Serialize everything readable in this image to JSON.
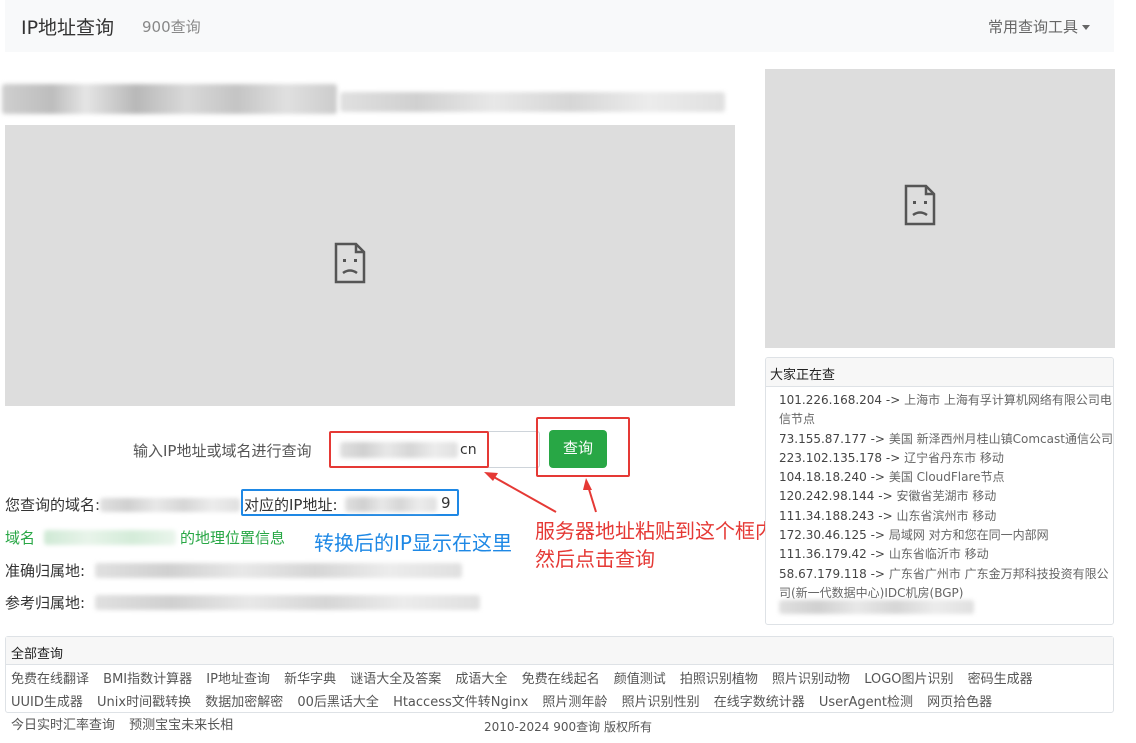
{
  "navbar": {
    "brand": "IP地址查询",
    "sub": "900查询",
    "tools": "常用查询工具"
  },
  "search": {
    "label": "输入IP地址或域名进行查询",
    "input_value_visible": "cn",
    "button": "查询"
  },
  "results": {
    "domain_label": "您查询的域名:",
    "ip_label": "对应的IP地址:",
    "ip_tail": "9",
    "geo_prefix": "域名",
    "geo_suffix": "的地理位置信息",
    "accurate_label": "准确归属地:",
    "reference_label": "参考归属地:"
  },
  "annotations": {
    "blue": "转换后的IP显示在这里",
    "red_line1": "服务器地址粘贴到这个框内",
    "red_line2": "然后点击查询"
  },
  "side_panel": {
    "title": "大家正在查",
    "items": [
      {
        "ip": "101.226.168.204 ->",
        "loc": "上海市 上海有孚计算机网络有限公司电信节点"
      },
      {
        "ip": "73.155.87.177 ->",
        "loc": "美国 新泽西州月桂山镇Comcast通信公司"
      },
      {
        "ip": "223.102.135.178 ->",
        "loc": "辽宁省丹东市 移动"
      },
      {
        "ip": "104.18.18.240 ->",
        "loc": "美国 CloudFlare节点"
      },
      {
        "ip": "120.242.98.144 ->",
        "loc": "安徽省芜湖市 移动"
      },
      {
        "ip": "111.34.188.243 ->",
        "loc": "山东省滨州市 移动"
      },
      {
        "ip": "172.30.46.125 ->",
        "loc": "局域网 对方和您在同一内部网"
      },
      {
        "ip": "111.36.179.42 ->",
        "loc": "山东省临沂市 移动"
      },
      {
        "ip": "58.67.179.118 ->",
        "loc": "广东省广州市 广东金万邦科技投资有限公司(新一代数据中心)IDC机房(BGP)"
      }
    ]
  },
  "all_queries": {
    "title": "全部查询",
    "links": [
      "免费在线翻译",
      "BMI指数计算器",
      "IP地址查询",
      "新华字典",
      "谜语大全及答案",
      "成语大全",
      "免费在线起名",
      "颜值测试",
      "拍照识别植物",
      "照片识别动物",
      "LOGO图片识别",
      "密码生成器",
      "UUID生成器",
      "Unix时间戳转换",
      "数据加密解密",
      "00后黑话大全",
      "Htaccess文件转Nginx",
      "照片测年龄",
      "照片识别性别",
      "在线字数统计器",
      "UserAgent检测",
      "网页拾色器",
      "今日实时汇率查询",
      "预测宝宝未来长相"
    ]
  },
  "footer": "2010-2024 900查询 版权所有"
}
